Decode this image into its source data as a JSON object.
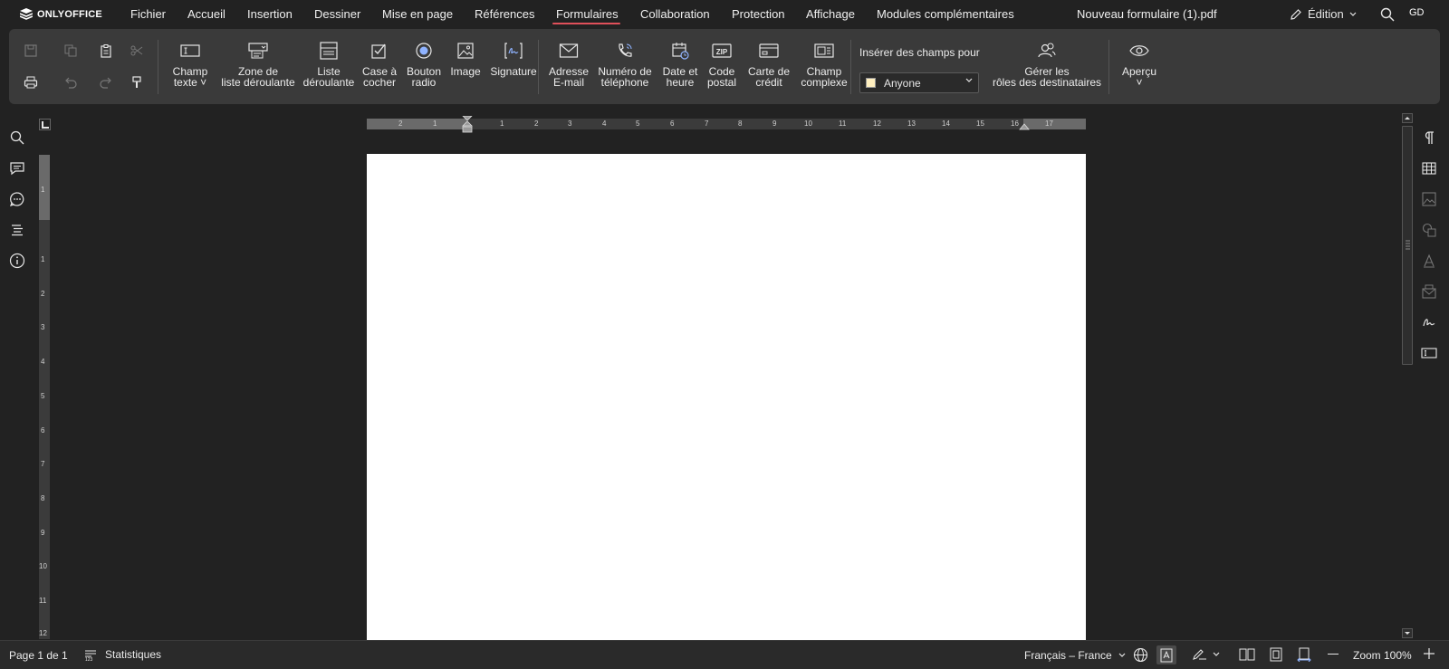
{
  "app": {
    "logo_text": "ONLYOFFICE",
    "document_title": "Nouveau formulaire (1).pdf",
    "mode_label": "Édition",
    "user_initials": "GD"
  },
  "menu": {
    "items": [
      "Fichier",
      "Accueil",
      "Insertion",
      "Dessiner",
      "Mise en page",
      "Références",
      "Formulaires",
      "Collaboration",
      "Protection",
      "Affichage",
      "Modules complémentaires"
    ],
    "active": "Formulaires"
  },
  "toolbar": {
    "fields": {
      "text_field": [
        "Champ",
        "texte"
      ],
      "combo_box": [
        "Zone de",
        "liste déroulante"
      ],
      "dropdown": [
        "Liste",
        "déroulante"
      ],
      "checkbox": [
        "Case à",
        "cocher"
      ],
      "radio": [
        "Bouton",
        "radio"
      ],
      "image": "Image",
      "signature": "Signature",
      "email": [
        "Adresse",
        "E-mail"
      ],
      "phone": [
        "Numéro de",
        "téléphone"
      ],
      "datetime": [
        "Date et",
        "heure"
      ],
      "zip": [
        "Code",
        "postal"
      ],
      "credit_card": [
        "Carte de",
        "crédit"
      ],
      "complex": [
        "Champ",
        "complexe"
      ]
    },
    "insert_for_label": "Insérer des champs pour",
    "role_selected": "Anyone",
    "role_color": "#ffefbf",
    "manage_roles": [
      "Gérer les",
      "rôles des destinataires"
    ],
    "preview_label": "Aperçu"
  },
  "rulers": {
    "horizontal_numbers": [
      "2",
      "1",
      "1",
      "2",
      "3",
      "4",
      "5",
      "6",
      "7",
      "8",
      "9",
      "10",
      "11",
      "12",
      "13",
      "14",
      "15",
      "16",
      "17"
    ],
    "vertical_numbers": [
      "1",
      "1",
      "2",
      "3",
      "4",
      "5",
      "6",
      "7",
      "8",
      "9",
      "10",
      "11",
      "12"
    ]
  },
  "statusbar": {
    "page_info": "Page 1 de 1",
    "statistics": "Statistiques",
    "language": "Français – France",
    "zoom": "Zoom 100%"
  },
  "colors": {
    "accent_underline": "#e0505a",
    "background": "#222222",
    "toolbar": "#3a3a3a",
    "page": "#ffffff"
  }
}
